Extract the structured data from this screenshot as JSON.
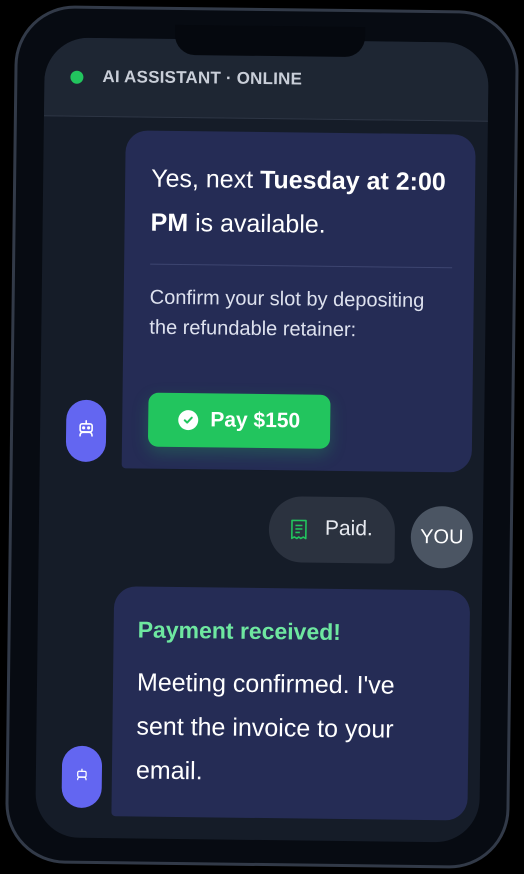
{
  "header": {
    "title": "AI ASSISTANT · ONLINE",
    "status": "online"
  },
  "messages": {
    "m1": {
      "text_before": "Yes, next ",
      "bold_1": "Tuesday at 2:00 PM",
      "text_after": " is available.",
      "confirm_text": "Confirm your slot by depositing the refundable retainer:",
      "pay_button": "Pay $150"
    },
    "m2": {
      "text": "Paid."
    },
    "you_avatar": "YOU",
    "m3": {
      "heading": "Payment received!",
      "body": "Meeting confirmed. I've sent the invoice to your email."
    }
  },
  "colors": {
    "accent_green": "#22c55e",
    "bot_avatar": "#6366f1",
    "bubble_bot": "#252c55",
    "bubble_user": "#2b323f"
  },
  "icons": [
    "robot-icon",
    "check-circle-icon",
    "receipt-icon"
  ]
}
